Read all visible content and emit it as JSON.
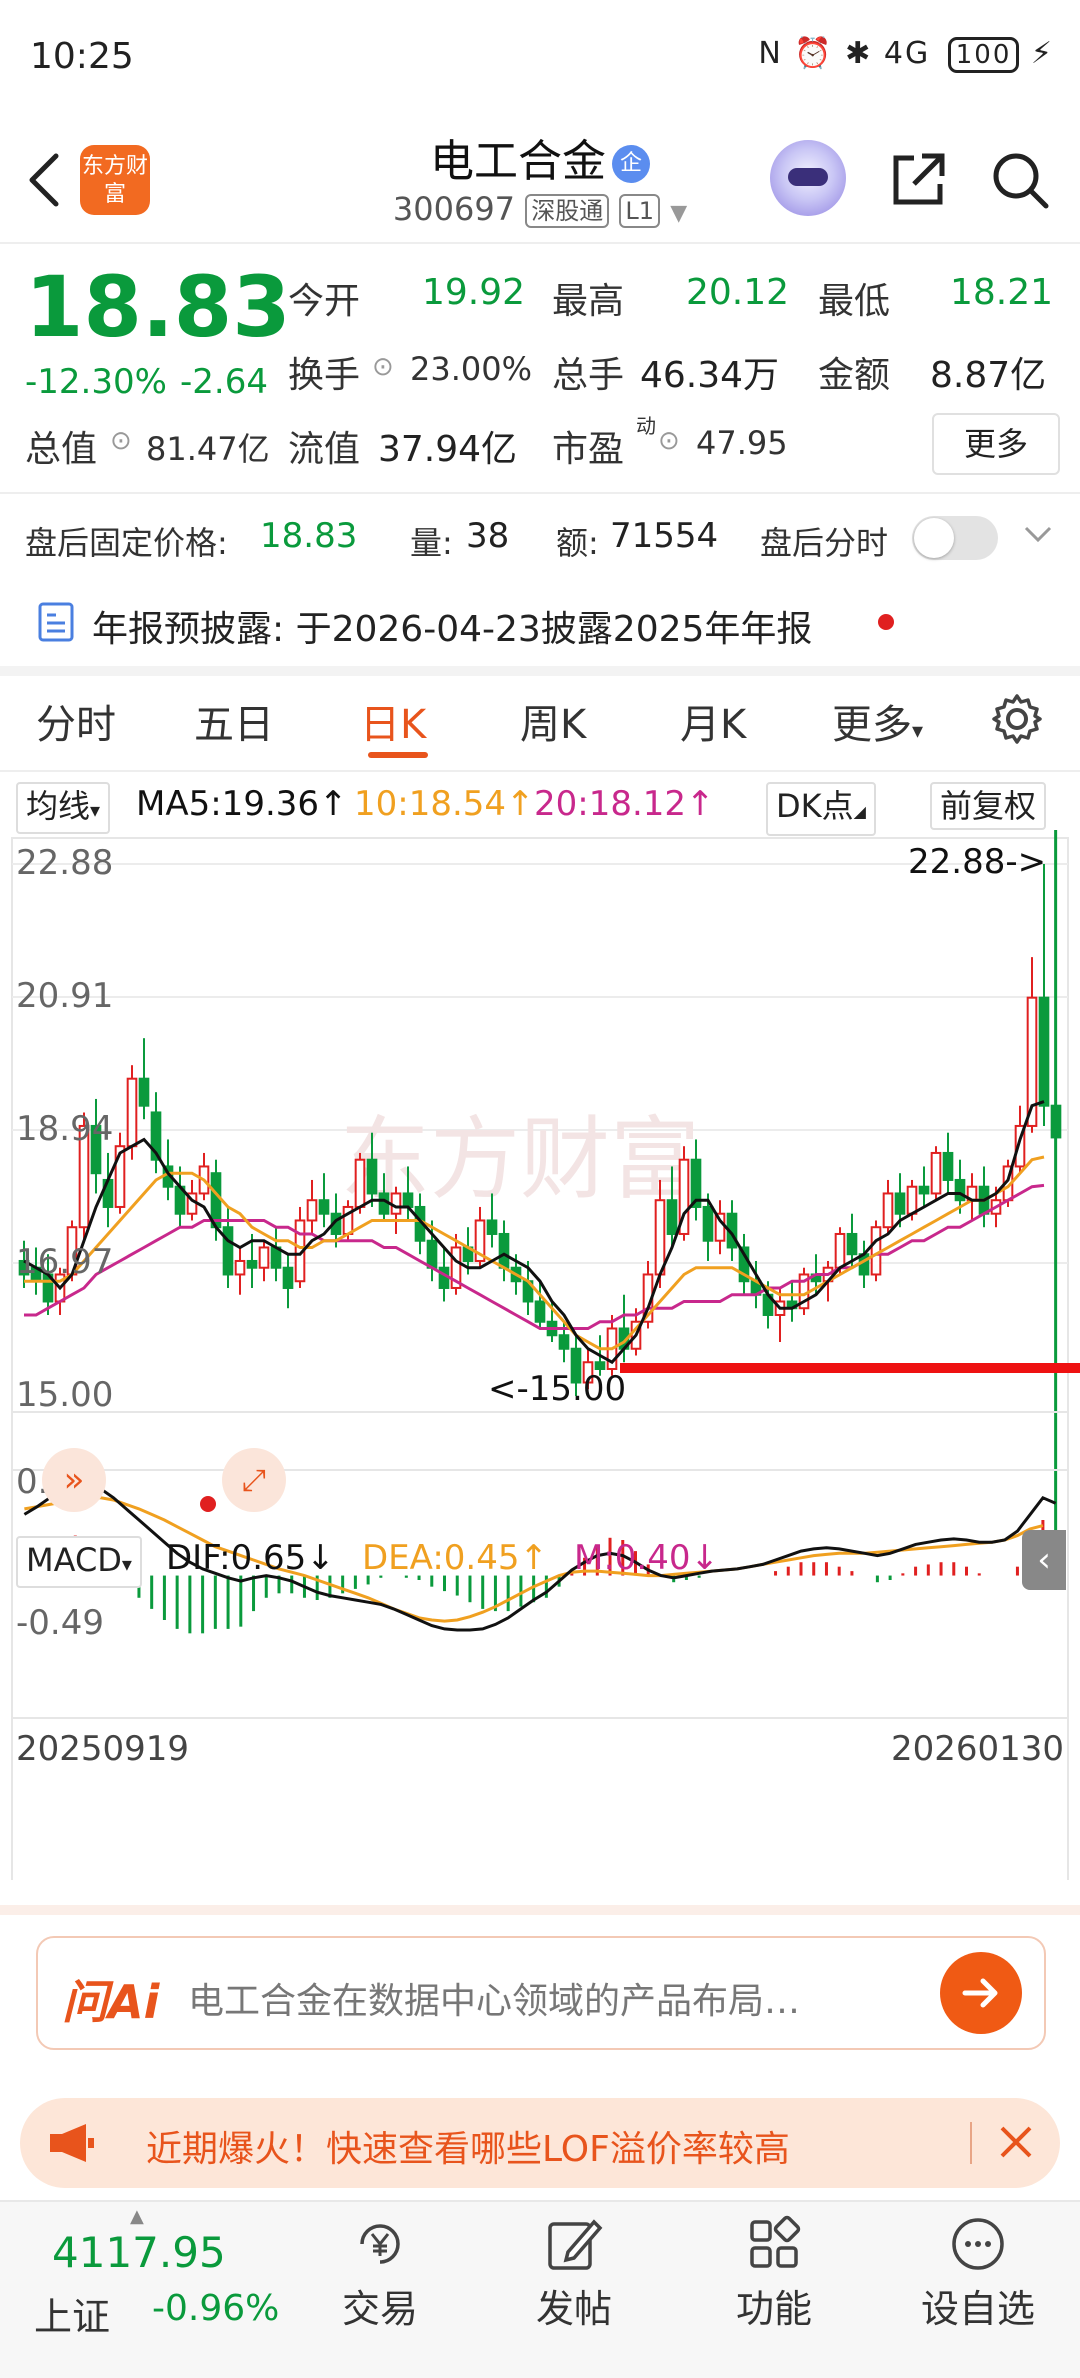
{
  "status_bar": {
    "time": "10:25",
    "icons_text": "N ⏰ ✱ 4G",
    "battery": "100"
  },
  "header": {
    "logo_text": "东方财富",
    "stock_name": "电工合金",
    "stock_badge": "企",
    "stock_code": "300697",
    "tag_connect": "深股通",
    "tag_level": "L1"
  },
  "quote": {
    "price": "18.83",
    "change_pct": "-12.30%",
    "change_amt": "-2.64",
    "open_label": "今开",
    "open": "19.92",
    "high_label": "最高",
    "high": "20.12",
    "low_label": "最低",
    "low": "18.21",
    "turnover_label": "换手",
    "turnover": "23.00%",
    "volume_label": "总手",
    "volume": "46.34万",
    "amount_label": "金额",
    "amount": "8.87亿",
    "mktcap_label": "总值",
    "mktcap": "81.47亿",
    "float_label": "流值",
    "float_cap": "37.94亿",
    "pe_label": "市盈",
    "pe_sup": "动",
    "pe": "47.95",
    "more_label": "更多"
  },
  "after_hours": {
    "price_label": "盘后固定价格:",
    "price": "18.83",
    "vol_label": "量:",
    "vol": "38",
    "amt_label": "额:",
    "amt": "71554",
    "timeshare_label": "盘后分时"
  },
  "notice": {
    "label": "年报预披露:",
    "text": "于2026-04-23披露2025年年报"
  },
  "tabs": [
    "分时",
    "五日",
    "日K",
    "周K",
    "月K",
    "更多"
  ],
  "chart": {
    "ma_selector": "均线",
    "ma5": "MA5:19.36↑",
    "ma10": "10:18.54↑",
    "ma20": "20:18.12↑",
    "dk_label": "DK点",
    "adjust_label": "前复权",
    "y_labels": [
      "22.88",
      "20.91",
      "18.94",
      "16.97",
      "15.00"
    ],
    "high_marker": "22.88->",
    "low_marker": "<-15.00",
    "macd_selector": "MACD",
    "dif": "DIF:0.65↓",
    "dea": "DEA:0.45↑",
    "m": "M:0.40↓",
    "macd_top": "0.86",
    "macd_bottom": "-0.49",
    "date_start": "20250919",
    "date_end": "20260130",
    "colors": {
      "up": "#e02020",
      "down": "#0a9a3c",
      "ma5": "#111111",
      "ma10": "#f0a020",
      "ma20": "#c8288c"
    }
  },
  "chart_data": {
    "type": "candlestick",
    "ylim": [
      15.0,
      22.88
    ],
    "macd_range": [
      -0.49,
      0.86
    ],
    "candles": [
      {
        "o": 17.0,
        "h": 17.3,
        "l": 16.6,
        "c": 16.8
      },
      {
        "o": 16.9,
        "h": 17.2,
        "l": 16.5,
        "c": 16.7
      },
      {
        "o": 16.8,
        "h": 17.1,
        "l": 16.2,
        "c": 16.4
      },
      {
        "o": 16.4,
        "h": 16.9,
        "l": 16.2,
        "c": 16.8
      },
      {
        "o": 16.8,
        "h": 17.6,
        "l": 16.7,
        "c": 17.5
      },
      {
        "o": 17.5,
        "h": 19.2,
        "l": 17.3,
        "c": 19.0
      },
      {
        "o": 19.0,
        "h": 19.4,
        "l": 18.0,
        "c": 18.3
      },
      {
        "o": 18.2,
        "h": 18.6,
        "l": 17.5,
        "c": 17.8
      },
      {
        "o": 17.8,
        "h": 18.9,
        "l": 17.7,
        "c": 18.7
      },
      {
        "o": 18.7,
        "h": 19.9,
        "l": 18.5,
        "c": 19.7
      },
      {
        "o": 19.7,
        "h": 20.3,
        "l": 19.1,
        "c": 19.3
      },
      {
        "o": 19.2,
        "h": 19.5,
        "l": 18.3,
        "c": 18.5
      },
      {
        "o": 18.4,
        "h": 18.8,
        "l": 17.9,
        "c": 18.1
      },
      {
        "o": 18.1,
        "h": 18.4,
        "l": 17.5,
        "c": 17.7
      },
      {
        "o": 17.7,
        "h": 18.2,
        "l": 17.6,
        "c": 18.0
      },
      {
        "o": 18.0,
        "h": 18.6,
        "l": 17.9,
        "c": 18.4
      },
      {
        "o": 18.3,
        "h": 18.5,
        "l": 17.3,
        "c": 17.5
      },
      {
        "o": 17.5,
        "h": 17.8,
        "l": 16.6,
        "c": 16.8
      },
      {
        "o": 16.8,
        "h": 17.2,
        "l": 16.5,
        "c": 17.0
      },
      {
        "o": 17.0,
        "h": 17.4,
        "l": 16.6,
        "c": 16.9
      },
      {
        "o": 16.9,
        "h": 17.3,
        "l": 16.7,
        "c": 17.2
      },
      {
        "o": 17.2,
        "h": 17.5,
        "l": 16.7,
        "c": 16.9
      },
      {
        "o": 16.9,
        "h": 17.1,
        "l": 16.3,
        "c": 16.6
      },
      {
        "o": 16.7,
        "h": 17.8,
        "l": 16.6,
        "c": 17.6
      },
      {
        "o": 17.6,
        "h": 18.2,
        "l": 17.4,
        "c": 17.9
      },
      {
        "o": 17.9,
        "h": 18.3,
        "l": 17.5,
        "c": 17.7
      },
      {
        "o": 17.7,
        "h": 18.0,
        "l": 17.2,
        "c": 17.4
      },
      {
        "o": 17.4,
        "h": 17.9,
        "l": 17.3,
        "c": 17.8
      },
      {
        "o": 17.8,
        "h": 18.6,
        "l": 17.7,
        "c": 18.5
      },
      {
        "o": 18.5,
        "h": 18.9,
        "l": 17.8,
        "c": 18.0
      },
      {
        "o": 18.0,
        "h": 18.3,
        "l": 17.6,
        "c": 17.7
      },
      {
        "o": 17.7,
        "h": 18.1,
        "l": 17.4,
        "c": 18.0
      },
      {
        "o": 18.0,
        "h": 18.4,
        "l": 17.6,
        "c": 17.8
      },
      {
        "o": 17.8,
        "h": 18.0,
        "l": 17.1,
        "c": 17.3
      },
      {
        "o": 17.3,
        "h": 17.6,
        "l": 16.7,
        "c": 16.9
      },
      {
        "o": 16.9,
        "h": 17.2,
        "l": 16.4,
        "c": 16.6
      },
      {
        "o": 16.6,
        "h": 17.4,
        "l": 16.5,
        "c": 17.2
      },
      {
        "o": 17.2,
        "h": 17.5,
        "l": 16.8,
        "c": 17.0
      },
      {
        "o": 17.0,
        "h": 17.8,
        "l": 16.9,
        "c": 17.6
      },
      {
        "o": 17.6,
        "h": 18.0,
        "l": 17.2,
        "c": 17.4
      },
      {
        "o": 17.4,
        "h": 17.6,
        "l": 16.7,
        "c": 16.9
      },
      {
        "o": 16.9,
        "h": 17.1,
        "l": 16.5,
        "c": 16.7
      },
      {
        "o": 16.7,
        "h": 17.0,
        "l": 16.2,
        "c": 16.4
      },
      {
        "o": 16.4,
        "h": 16.7,
        "l": 16.0,
        "c": 16.1
      },
      {
        "o": 16.1,
        "h": 16.4,
        "l": 15.8,
        "c": 15.9
      },
      {
        "o": 15.9,
        "h": 16.1,
        "l": 15.5,
        "c": 15.7
      },
      {
        "o": 15.7,
        "h": 15.9,
        "l": 15.0,
        "c": 15.2
      },
      {
        "o": 15.2,
        "h": 15.7,
        "l": 15.1,
        "c": 15.5
      },
      {
        "o": 15.5,
        "h": 15.9,
        "l": 15.3,
        "c": 15.4
      },
      {
        "o": 15.4,
        "h": 16.2,
        "l": 15.3,
        "c": 16.0
      },
      {
        "o": 16.0,
        "h": 16.5,
        "l": 15.5,
        "c": 15.7
      },
      {
        "o": 15.7,
        "h": 16.3,
        "l": 15.6,
        "c": 16.1
      },
      {
        "o": 16.1,
        "h": 17.0,
        "l": 16.0,
        "c": 16.8
      },
      {
        "o": 16.8,
        "h": 18.2,
        "l": 16.6,
        "c": 17.9
      },
      {
        "o": 17.9,
        "h": 18.4,
        "l": 17.2,
        "c": 17.4
      },
      {
        "o": 17.4,
        "h": 18.7,
        "l": 17.3,
        "c": 18.5
      },
      {
        "o": 18.5,
        "h": 18.8,
        "l": 17.6,
        "c": 17.8
      },
      {
        "o": 17.8,
        "h": 18.0,
        "l": 17.0,
        "c": 17.3
      },
      {
        "o": 17.3,
        "h": 17.9,
        "l": 17.1,
        "c": 17.7
      },
      {
        "o": 17.7,
        "h": 17.9,
        "l": 17.0,
        "c": 17.2
      },
      {
        "o": 17.2,
        "h": 17.4,
        "l": 16.5,
        "c": 16.7
      },
      {
        "o": 16.7,
        "h": 17.0,
        "l": 16.3,
        "c": 16.5
      },
      {
        "o": 16.5,
        "h": 16.7,
        "l": 16.0,
        "c": 16.2
      },
      {
        "o": 16.2,
        "h": 16.6,
        "l": 15.8,
        "c": 16.4
      },
      {
        "o": 16.4,
        "h": 16.7,
        "l": 16.1,
        "c": 16.3
      },
      {
        "o": 16.3,
        "h": 16.9,
        "l": 16.2,
        "c": 16.8
      },
      {
        "o": 16.8,
        "h": 17.1,
        "l": 16.5,
        "c": 16.7
      },
      {
        "o": 16.7,
        "h": 17.0,
        "l": 16.4,
        "c": 16.9
      },
      {
        "o": 16.9,
        "h": 17.5,
        "l": 16.8,
        "c": 17.4
      },
      {
        "o": 17.4,
        "h": 17.7,
        "l": 16.9,
        "c": 17.1
      },
      {
        "o": 17.1,
        "h": 17.3,
        "l": 16.6,
        "c": 16.8
      },
      {
        "o": 16.8,
        "h": 17.6,
        "l": 16.7,
        "c": 17.5
      },
      {
        "o": 17.5,
        "h": 18.2,
        "l": 17.4,
        "c": 18.0
      },
      {
        "o": 18.0,
        "h": 18.3,
        "l": 17.5,
        "c": 17.7
      },
      {
        "o": 17.7,
        "h": 18.2,
        "l": 17.6,
        "c": 18.1
      },
      {
        "o": 18.1,
        "h": 18.4,
        "l": 17.8,
        "c": 18.0
      },
      {
        "o": 18.0,
        "h": 18.7,
        "l": 17.9,
        "c": 18.6
      },
      {
        "o": 18.6,
        "h": 18.9,
        "l": 18.0,
        "c": 18.2
      },
      {
        "o": 18.2,
        "h": 18.5,
        "l": 17.7,
        "c": 17.9
      },
      {
        "o": 17.9,
        "h": 18.3,
        "l": 17.6,
        "c": 18.1
      },
      {
        "o": 18.1,
        "h": 18.4,
        "l": 17.5,
        "c": 17.7
      },
      {
        "o": 17.7,
        "h": 18.1,
        "l": 17.5,
        "c": 17.9
      },
      {
        "o": 17.9,
        "h": 18.5,
        "l": 17.8,
        "c": 18.4
      },
      {
        "o": 18.4,
        "h": 19.3,
        "l": 18.3,
        "c": 19.0
      },
      {
        "o": 19.0,
        "h": 21.5,
        "l": 18.9,
        "c": 20.9
      },
      {
        "o": 20.9,
        "h": 22.88,
        "l": 19.0,
        "c": 19.3
      },
      {
        "o": 19.3,
        "h": 19.9,
        "l": 18.2,
        "c": 18.83
      }
    ],
    "ma5": [
      17.0,
      16.9,
      16.8,
      16.6,
      16.8,
      17.3,
      17.8,
      18.2,
      18.6,
      18.7,
      18.8,
      18.6,
      18.3,
      18.1,
      17.9,
      17.8,
      17.5,
      17.3,
      17.2,
      17.3,
      17.3,
      17.2,
      17.1,
      17.1,
      17.3,
      17.4,
      17.6,
      17.7,
      17.8,
      17.9,
      17.9,
      17.8,
      17.8,
      17.6,
      17.4,
      17.2,
      17.0,
      16.9,
      16.9,
      17.0,
      17.1,
      17.0,
      16.9,
      16.7,
      16.4,
      16.2,
      15.9,
      15.7,
      15.6,
      15.5,
      15.7,
      15.9,
      16.3,
      16.8,
      17.2,
      17.7,
      17.9,
      17.9,
      17.6,
      17.4,
      17.1,
      16.8,
      16.5,
      16.3,
      16.3,
      16.4,
      16.5,
      16.7,
      16.9,
      17.0,
      17.1,
      17.3,
      17.4,
      17.6,
      17.7,
      17.8,
      17.9,
      18.0,
      18.0,
      17.9,
      17.9,
      18.0,
      18.2,
      18.8,
      19.3,
      19.36
    ],
    "ma10": [
      16.7,
      16.7,
      16.7,
      16.7,
      16.8,
      17.0,
      17.2,
      17.4,
      17.6,
      17.8,
      18.0,
      18.2,
      18.3,
      18.3,
      18.3,
      18.2,
      18.0,
      17.8,
      17.7,
      17.5,
      17.4,
      17.3,
      17.3,
      17.2,
      17.2,
      17.3,
      17.3,
      17.4,
      17.5,
      17.6,
      17.6,
      17.6,
      17.6,
      17.6,
      17.5,
      17.4,
      17.3,
      17.2,
      17.1,
      17.0,
      16.9,
      16.8,
      16.7,
      16.5,
      16.3,
      16.1,
      15.9,
      15.8,
      15.7,
      15.7,
      15.8,
      16.0,
      16.2,
      16.4,
      16.6,
      16.8,
      16.9,
      16.9,
      16.9,
      16.9,
      16.8,
      16.7,
      16.6,
      16.5,
      16.5,
      16.5,
      16.6,
      16.7,
      16.8,
      16.9,
      17.0,
      17.1,
      17.2,
      17.3,
      17.4,
      17.5,
      17.6,
      17.7,
      17.8,
      17.9,
      17.9,
      18.0,
      18.1,
      18.3,
      18.5,
      18.54
    ],
    "ma20": [
      16.2,
      16.2,
      16.3,
      16.4,
      16.5,
      16.6,
      16.8,
      16.9,
      17.0,
      17.1,
      17.2,
      17.3,
      17.4,
      17.5,
      17.5,
      17.6,
      17.6,
      17.6,
      17.6,
      17.6,
      17.6,
      17.5,
      17.5,
      17.4,
      17.4,
      17.3,
      17.3,
      17.3,
      17.3,
      17.3,
      17.2,
      17.2,
      17.1,
      17.0,
      16.9,
      16.8,
      16.7,
      16.6,
      16.5,
      16.4,
      16.3,
      16.2,
      16.1,
      16.0,
      16.0,
      16.0,
      16.0,
      16.0,
      16.1,
      16.1,
      16.2,
      16.2,
      16.3,
      16.3,
      16.3,
      16.4,
      16.4,
      16.4,
      16.4,
      16.5,
      16.5,
      16.5,
      16.6,
      16.6,
      16.7,
      16.7,
      16.8,
      16.8,
      16.9,
      16.9,
      17.0,
      17.1,
      17.1,
      17.2,
      17.3,
      17.3,
      17.4,
      17.5,
      17.5,
      17.6,
      17.7,
      17.8,
      17.9,
      18.0,
      18.1,
      18.12
    ],
    "dif": [
      0.55,
      0.62,
      0.7,
      0.78,
      0.86,
      0.84,
      0.78,
      0.7,
      0.6,
      0.5,
      0.4,
      0.3,
      0.2,
      0.12,
      0.06,
      0.02,
      -0.02,
      -0.05,
      -0.02,
      0.0,
      -0.02,
      -0.05,
      -0.1,
      -0.15,
      -0.18,
      -0.2,
      -0.22,
      -0.24,
      -0.26,
      -0.3,
      -0.35,
      -0.4,
      -0.45,
      -0.48,
      -0.49,
      -0.49,
      -0.48,
      -0.44,
      -0.38,
      -0.3,
      -0.22,
      -0.15,
      -0.05,
      0.05,
      0.12,
      0.18,
      0.2,
      0.18,
      0.12,
      0.05,
      0.0,
      -0.02,
      0.0,
      0.02,
      0.04,
      0.05,
      0.06,
      0.08,
      0.1,
      0.14,
      0.18,
      0.22,
      0.24,
      0.25,
      0.24,
      0.22,
      0.2,
      0.18,
      0.2,
      0.24,
      0.28,
      0.3,
      0.32,
      0.33,
      0.32,
      0.3,
      0.3,
      0.32,
      0.4,
      0.55,
      0.7,
      0.65
    ],
    "dea": [
      0.6,
      0.62,
      0.64,
      0.66,
      0.68,
      0.7,
      0.7,
      0.68,
      0.64,
      0.6,
      0.55,
      0.5,
      0.44,
      0.38,
      0.32,
      0.26,
      0.22,
      0.18,
      0.14,
      0.1,
      0.06,
      0.03,
      0.0,
      -0.04,
      -0.08,
      -0.12,
      -0.16,
      -0.2,
      -0.25,
      -0.3,
      -0.34,
      -0.38,
      -0.4,
      -0.41,
      -0.4,
      -0.37,
      -0.33,
      -0.28,
      -0.22,
      -0.16,
      -0.1,
      -0.05,
      0.0,
      0.03,
      0.04,
      0.04,
      0.03,
      0.02,
      0.01,
      0.0,
      0.0,
      0.01,
      0.02,
      0.03,
      0.04,
      0.05,
      0.06,
      0.08,
      0.1,
      0.12,
      0.14,
      0.16,
      0.18,
      0.19,
      0.2,
      0.2,
      0.2,
      0.21,
      0.22,
      0.23,
      0.24,
      0.25,
      0.26,
      0.27,
      0.28,
      0.29,
      0.3,
      0.32,
      0.36,
      0.42,
      0.45
    ]
  },
  "ai_box": {
    "brand": "问Ai",
    "prompt": "电工合金在数据中心领域的产品布局…"
  },
  "promo": {
    "text": "近期爆火！快速查看哪些LOF溢价率较高"
  },
  "bottom_nav": {
    "index_value": "4117.95",
    "index_name": "上证",
    "index_change": "-0.96%",
    "items": [
      "交易",
      "发帖",
      "功能",
      "设自选"
    ]
  }
}
